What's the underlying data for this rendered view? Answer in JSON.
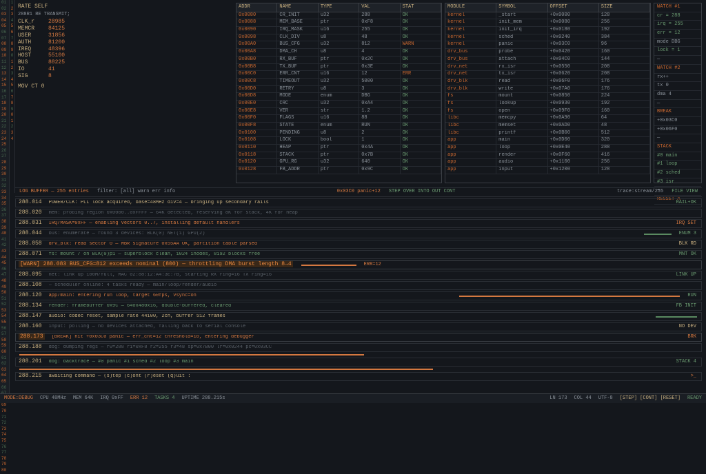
{
  "gutter_numbers": [
    "01",
    "02",
    "03",
    "04",
    "05",
    "06",
    "07",
    "08",
    "09",
    "10",
    "11",
    "12",
    "13",
    "14",
    "15",
    "16",
    "17",
    "18",
    "19",
    "20",
    "21",
    "22",
    "23",
    "24",
    "25",
    "26",
    "27",
    "28",
    "29",
    "30",
    "31",
    "32",
    "33",
    "34",
    "35",
    "36",
    "37",
    "38",
    "39",
    "40",
    "41",
    "42",
    "43",
    "44",
    "45",
    "46",
    "47",
    "48",
    "49",
    "50",
    "51",
    "52",
    "53",
    "54",
    "55",
    "56",
    "57",
    "58",
    "59",
    "60",
    "61",
    "62",
    "63",
    "64",
    "65",
    "66",
    "67",
    "68",
    "69",
    "70",
    "71",
    "72",
    "73",
    "74",
    "75",
    "76",
    "77",
    "78",
    "79",
    "80"
  ],
  "line_col": [
    "1",
    "2",
    "3",
    "4",
    "5",
    "6",
    "7",
    "8",
    "9",
    "0",
    "1",
    "2",
    "3",
    "4",
    "5",
    "6",
    "7",
    "8",
    "9",
    "0",
    "1",
    "2",
    "3",
    "4"
  ],
  "code": {
    "header": "RATE SELF",
    "header2": "288R1 RE TRANSMIT;",
    "lines": [
      {
        "k": "CLK_r",
        "v": "28985"
      },
      {
        "k": "MEMCR",
        "v": "84125"
      },
      {
        "k": "USER",
        "v": "31856"
      },
      {
        "k": "AUTH",
        "v": "81200"
      },
      {
        "k": "IREQ",
        "v": "48396"
      },
      {
        "k": "HOST",
        "v": "55100"
      },
      {
        "k": "BUS",
        "v": "88225"
      },
      {
        "k": "IO",
        "v": "41"
      },
      {
        "k": "SIG",
        "v": "8"
      }
    ],
    "footer": "MOV CT 0"
  },
  "tables": {
    "t1": {
      "cols": [
        "ADDR",
        "NAME",
        "TYPE",
        "VAL",
        "STAT"
      ],
      "rows": [
        [
          "0x0080",
          "CR_INIT",
          "u32",
          "288",
          "OK"
        ],
        [
          "0x0088",
          "MEM_BASE",
          "ptr",
          "0xF8",
          "OK"
        ],
        [
          "0x0090",
          "IRQ_MASK",
          "u16",
          "255",
          "OK"
        ],
        [
          "0x0098",
          "CLK_DIV",
          "u8",
          "48",
          "OK"
        ],
        [
          "0x00A0",
          "BUS_CFG",
          "u32",
          "812",
          "WARN"
        ],
        [
          "0x00A8",
          "DMA_CH",
          "u8",
          "4",
          "OK"
        ],
        [
          "0x00B0",
          "RX_BUF",
          "ptr",
          "0x2C",
          "OK"
        ],
        [
          "0x00B8",
          "TX_BUF",
          "ptr",
          "0x3E",
          "OK"
        ],
        [
          "0x00C0",
          "ERR_CNT",
          "u16",
          "12",
          "ERR"
        ],
        [
          "0x00C8",
          "TIMEOUT",
          "u32",
          "5000",
          "OK"
        ],
        [
          "0x00D0",
          "RETRY",
          "u8",
          "3",
          "OK"
        ],
        [
          "0x00D8",
          "MODE",
          "enum",
          "DBG",
          "OK"
        ],
        [
          "0x00E0",
          "CRC",
          "u32",
          "0xA4",
          "OK"
        ],
        [
          "0x00E8",
          "VER",
          "str",
          "1.2",
          "OK"
        ],
        [
          "0x00F0",
          "FLAGS",
          "u16",
          "88",
          "OK"
        ],
        [
          "0x00F8",
          "STATE",
          "enum",
          "RUN",
          "OK"
        ],
        [
          "0x0100",
          "PENDING",
          "u8",
          "2",
          "OK"
        ],
        [
          "0x0108",
          "LOCK",
          "bool",
          "1",
          "OK"
        ],
        [
          "0x0110",
          "HEAP",
          "ptr",
          "0x4A",
          "OK"
        ],
        [
          "0x0118",
          "STACK",
          "ptr",
          "0x7B",
          "OK"
        ],
        [
          "0x0120",
          "GPU_RG",
          "u32",
          "640",
          "OK"
        ],
        [
          "0x0128",
          "FB_ADDR",
          "ptr",
          "0x9C",
          "OK"
        ]
      ]
    },
    "t2": {
      "cols": [
        "MODULE",
        "SYMBOL",
        "OFFSET",
        "SIZE"
      ],
      "rows": [
        [
          "kernel",
          "_start",
          "+0x0000",
          "128"
        ],
        [
          "kernel",
          "init_mem",
          "+0x0080",
          "256"
        ],
        [
          "kernel",
          "init_irq",
          "+0x0180",
          "192"
        ],
        [
          "kernel",
          "sched",
          "+0x0240",
          "384"
        ],
        [
          "kernel",
          "panic",
          "+0x03C0",
          "96"
        ],
        [
          "drv_bus",
          "probe",
          "+0x0420",
          "160"
        ],
        [
          "drv_bus",
          "attach",
          "+0x04C0",
          "144"
        ],
        [
          "drv_net",
          "rx_isr",
          "+0x0550",
          "208"
        ],
        [
          "drv_net",
          "tx_isr",
          "+0x0620",
          "208"
        ],
        [
          "drv_blk",
          "read",
          "+0x06F0",
          "176"
        ],
        [
          "drv_blk",
          "write",
          "+0x07A0",
          "176"
        ],
        [
          "fs",
          "mount",
          "+0x0850",
          "224"
        ],
        [
          "fs",
          "lookup",
          "+0x0930",
          "192"
        ],
        [
          "fs",
          "open",
          "+0x09F0",
          "160"
        ],
        [
          "libc",
          "memcpy",
          "+0x0A90",
          "64"
        ],
        [
          "libc",
          "memset",
          "+0x0AD0",
          "48"
        ],
        [
          "libc",
          "printf",
          "+0x0B00",
          "512"
        ],
        [
          "app",
          "main",
          "+0x0D00",
          "320"
        ],
        [
          "app",
          "loop",
          "+0x0E40",
          "288"
        ],
        [
          "app",
          "render",
          "+0x0F60",
          "416"
        ],
        [
          "app",
          "audio",
          "+0x1100",
          "256"
        ],
        [
          "app",
          "input",
          "+0x1200",
          "128"
        ]
      ]
    },
    "side": [
      "WATCH #1",
      "cr = 288",
      "irq = 255",
      "err = 12",
      "mode DBG",
      "lock = 1",
      "—",
      "WATCH #2",
      "rx++",
      "tx 0",
      "dma 4",
      "—",
      "BREAK",
      "+0x03C0",
      "+0x06F0",
      "—",
      "STACK",
      "#0 main",
      "#1 loop",
      "#2 sched",
      "#3 isr",
      "—",
      "REGSET A"
    ]
  },
  "status": {
    "left": "LOG BUFFER — 255 entries",
    "filter": "filter: [all] warn err info",
    "center_a": "0x03C0 panic+12",
    "center_b": "STEP OVER INTO OUT CONT",
    "right_a": "trace:stream/255",
    "right_b": "FILE VIEW"
  },
  "logs": [
    {
      "cls": "y",
      "lbl": "288.014",
      "msg": "POWER/CLK: PLL lock acquired, base=48MHz div=4 — bringing up secondary rails",
      "tag": "RAIL+OK",
      "tagcls": "g",
      "bar": ""
    },
    {
      "cls": "dim",
      "lbl": "288.020",
      "msg": "mem: probing region 0x0000..0xFFFF — 64K detected, reserving 8K for stack, 4K for heap",
      "tag": "",
      "tagcls": "",
      "bar": ""
    },
    {
      "cls": "o",
      "lbl": "288.031",
      "msg": "IRQ/MASK=0xFF — enabling vectors 0..7, installing default handlers",
      "tag": "IRQ SET",
      "tagcls": "o",
      "bar": ""
    },
    {
      "cls": "dim",
      "lbl": "288.044",
      "msg": "bus: enumerate — found 3 devices: BLK(0) NET(1) GPU(2)",
      "tag": "ENUM 3",
      "tagcls": "g",
      "bar": "w40"
    },
    {
      "cls": "o",
      "lbl": "288.058",
      "msg": "drv_blk: read sector 0 — MBR signature 0x55AA OK, partition table parsed",
      "tag": "BLK RD",
      "tagcls": "y",
      "bar": ""
    },
    {
      "cls": "g",
      "lbl": "288.071",
      "msg": "fs: mount / on BLK(0)p1 — superblock clean, 1024 inodes, 8192 blocks free",
      "tag": "MNT OK",
      "tagcls": "g",
      "bar": ""
    },
    {
      "cls": "o",
      "lbl": "[WARN] 288.083 BUS_CFG=812 exceeds nominal (800) — throttling DMA burst length 8→4",
      "msg": "",
      "tag": "ERR=12",
      "tagcls": "o",
      "bar": "o80",
      "special": "hl"
    },
    {
      "cls": "dim",
      "lbl": "288.095",
      "msg": "net: link up 100M/full, MAC 02:88:12:A4:3E:7B, starting RX ring=16 TX ring=16",
      "tag": "LINK UP",
      "tagcls": "g",
      "bar": ""
    },
    {
      "cls": "dim",
      "lbl": "288.108",
      "msg": "— scheduler online: 4 tasks ready — main/loop/render/audio",
      "tag": "",
      "tagcls": "",
      "bar": ""
    },
    {
      "cls": "o",
      "lbl": "288.120",
      "msg": "app/main: entering run loop, target 60fps, vsync=on",
      "tag": "RUN",
      "tagcls": "g",
      "bar": "o320"
    },
    {
      "cls": "g",
      "lbl": "288.134",
      "msg": "render: framebuffer 0x9C — 640x480x16, double-buffered, cleared",
      "tag": "FB INIT",
      "tagcls": "g",
      "bar": ""
    },
    {
      "cls": "y",
      "lbl": "288.147",
      "msg": "audio: codec reset, sample rate 44100, 2ch, buffer 512 frames",
      "tag": "",
      "tagcls": "",
      "bar": "w60"
    },
    {
      "cls": "dim",
      "lbl": "288.160",
      "msg": "input: polling — no devices attached, falling back to serial console",
      "tag": "NO DEV",
      "tagcls": "y",
      "bar": ""
    },
    {
      "cls": "o",
      "lbl": "288.173",
      "msg": "[BREAK] hit +0x03C0 panic — err_cnt=12 threshold=10, entering debugger",
      "tag": "BRK",
      "tagcls": "o",
      "bar": "",
      "special": "hl"
    },
    {
      "cls": "dim",
      "lbl": "288.188",
      "msg": "dbg: dumping regs — r0=288 r1=0xF8 r2=255 r3=48 sp=0x7B00 lr=0x0244 pc=0x03CC",
      "tag": "",
      "tagcls": "",
      "bar": ""
    },
    {
      "cls": "dim",
      "lbl": "",
      "msg": "",
      "tag": "",
      "tagcls": "",
      "bar": "o500",
      "thin": true
    },
    {
      "cls": "g",
      "lbl": "288.201",
      "msg": "dbg: backtrace — #0 panic #1 sched #2 loop #3 main",
      "tag": "STACK 4",
      "tagcls": "g",
      "bar": ""
    },
    {
      "cls": "dim",
      "lbl": "",
      "msg": "",
      "tag": "",
      "tagcls": "",
      "bar": "o600",
      "thin": true
    },
    {
      "cls": "y",
      "lbl": "288.215",
      "msg": "awaiting command — (s)tep (c)ont (r)eset (q)uit :",
      "tag": ">_",
      "tagcls": "o",
      "bar": ""
    }
  ],
  "footer": {
    "a": "MODE:DEBUG",
    "b": "CPU 48MHz",
    "c": "MEM 64K",
    "d": "IRQ 0xFF",
    "e": "ERR 12",
    "f": "TASKS 4",
    "g": "UPTIME 288.215s",
    "h": "LN 173",
    "i": "COL 44",
    "j": "UTF-8",
    "k": "[STEP] [CONT] [RESET]",
    "l": "READY"
  }
}
